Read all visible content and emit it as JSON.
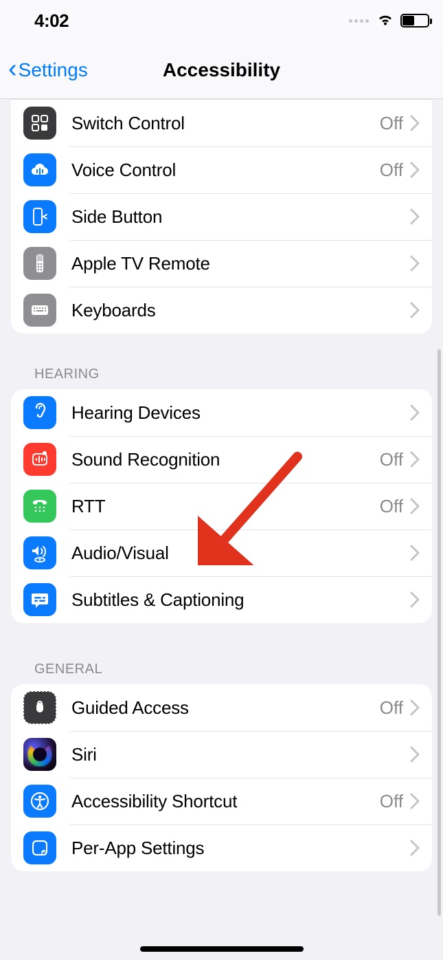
{
  "status_bar": {
    "time": "4:02"
  },
  "nav": {
    "back_label": "Settings",
    "title": "Accessibility"
  },
  "groups": {
    "physical": {
      "items": [
        {
          "label": "Switch Control",
          "value": "Off"
        },
        {
          "label": "Voice Control",
          "value": "Off"
        },
        {
          "label": "Side Button",
          "value": ""
        },
        {
          "label": "Apple TV Remote",
          "value": ""
        },
        {
          "label": "Keyboards",
          "value": ""
        }
      ]
    },
    "hearing": {
      "header": "HEARING",
      "items": [
        {
          "label": "Hearing Devices",
          "value": ""
        },
        {
          "label": "Sound Recognition",
          "value": "Off"
        },
        {
          "label": "RTT",
          "value": "Off"
        },
        {
          "label": "Audio/Visual",
          "value": ""
        },
        {
          "label": "Subtitles & Captioning",
          "value": ""
        }
      ]
    },
    "general": {
      "header": "GENERAL",
      "items": [
        {
          "label": "Guided Access",
          "value": "Off"
        },
        {
          "label": "Siri",
          "value": ""
        },
        {
          "label": "Accessibility Shortcut",
          "value": "Off"
        },
        {
          "label": "Per-App Settings",
          "value": ""
        }
      ]
    }
  },
  "value_off": "Off"
}
